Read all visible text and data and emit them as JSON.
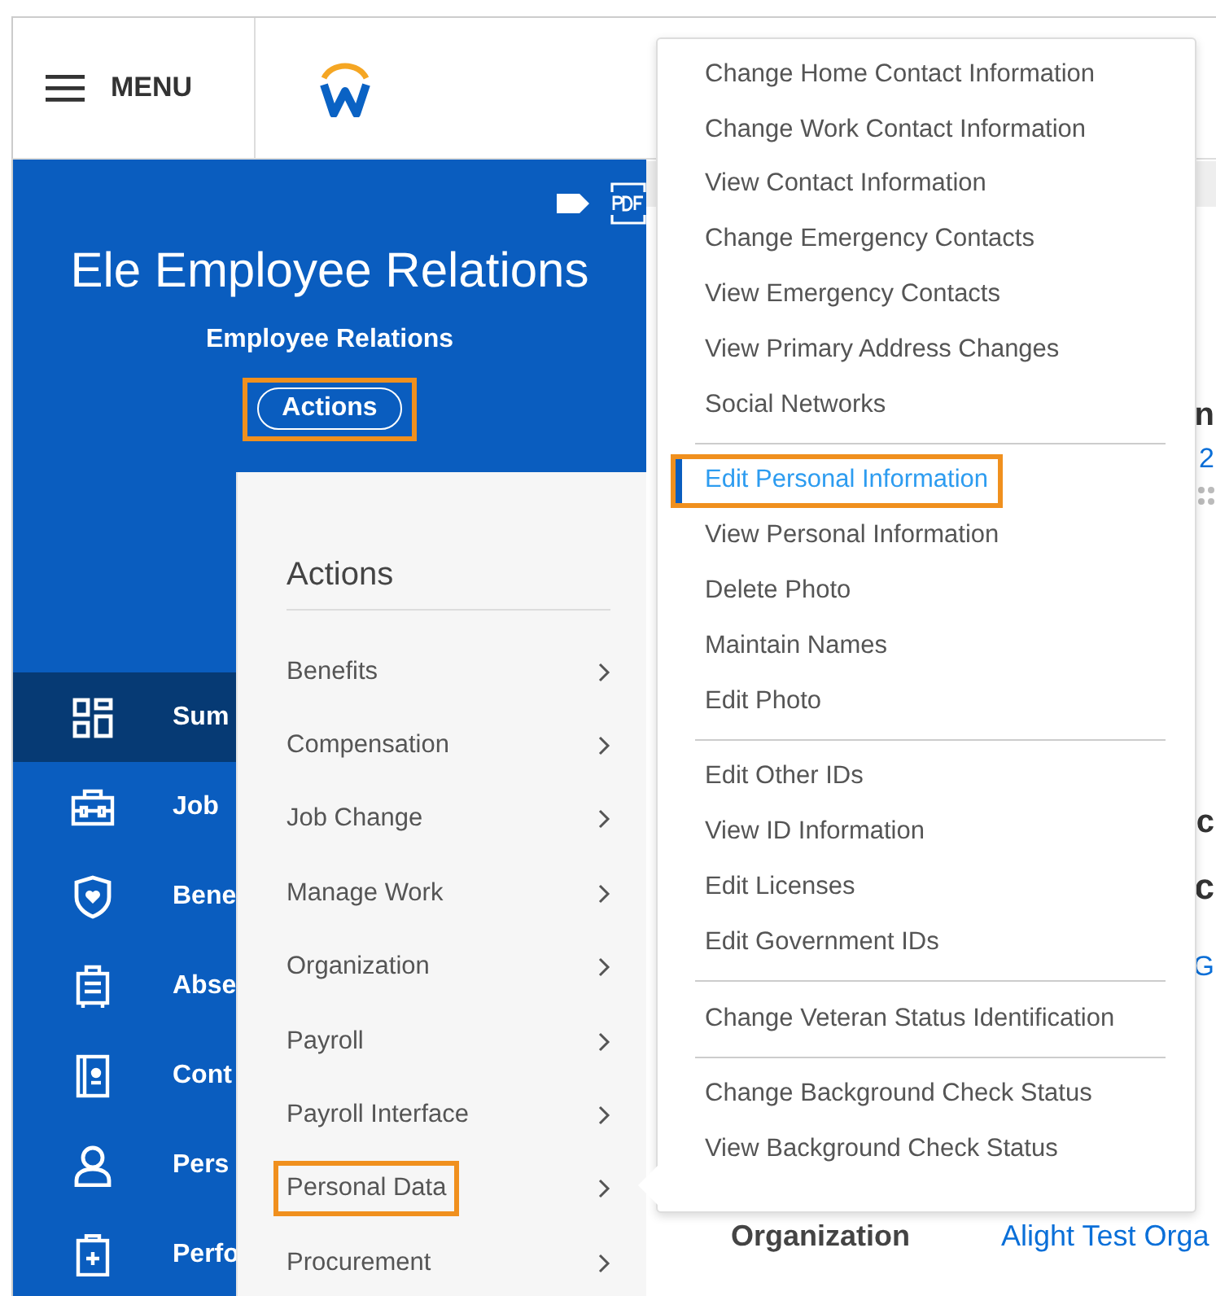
{
  "header": {
    "menu_label": "MENU"
  },
  "profile": {
    "name": "Ele Employee Relations",
    "subtitle": "Employee Relations",
    "actions_button": {
      "label": "Actions",
      "highlighted": true
    }
  },
  "sidebar": {
    "items": [
      {
        "label": "Sum",
        "selected": true
      },
      {
        "label": "Job",
        "selected": false
      },
      {
        "label": "Bene",
        "selected": false
      },
      {
        "label": "Abse",
        "selected": false
      },
      {
        "label": "Cont",
        "selected": false
      },
      {
        "label": "Pers",
        "selected": false
      },
      {
        "label": "Perfo",
        "selected": false
      }
    ]
  },
  "main": {
    "fragments": [
      {
        "kind": "heading",
        "text": "n"
      },
      {
        "kind": "link",
        "text": "2"
      },
      {
        "kind": "heading",
        "text": "c"
      },
      {
        "kind": "title",
        "text": "c"
      },
      {
        "kind": "link",
        "text": "G"
      }
    ],
    "field": {
      "label": "Organization",
      "value": "Alight Test Orga"
    }
  },
  "actions_menu": {
    "title": "Actions",
    "items": [
      {
        "label": "Benefits",
        "highlighted": false
      },
      {
        "label": "Compensation",
        "highlighted": false
      },
      {
        "label": "Job Change",
        "highlighted": false
      },
      {
        "label": "Manage Work",
        "highlighted": false
      },
      {
        "label": "Organization",
        "highlighted": false
      },
      {
        "label": "Payroll",
        "highlighted": false
      },
      {
        "label": "Payroll Interface",
        "highlighted": false
      },
      {
        "label": "Personal Data",
        "highlighted": true
      },
      {
        "label": "Procurement",
        "highlighted": false
      }
    ]
  },
  "submenu": {
    "groups": [
      {
        "items": [
          {
            "label": "Change Home Contact Information",
            "selected": false,
            "highlighted": false
          },
          {
            "label": "Change Work Contact Information",
            "selected": false,
            "highlighted": false
          },
          {
            "label": "View Contact Information",
            "selected": false,
            "highlighted": false
          },
          {
            "label": "Change Emergency Contacts",
            "selected": false,
            "highlighted": false
          },
          {
            "label": "View Emergency Contacts",
            "selected": false,
            "highlighted": false
          },
          {
            "label": "View Primary Address Changes",
            "selected": false,
            "highlighted": false
          },
          {
            "label": "Social Networks",
            "selected": false,
            "highlighted": false
          }
        ]
      },
      {
        "items": [
          {
            "label": "Edit Personal Information",
            "selected": true,
            "highlighted": true
          },
          {
            "label": "View Personal Information",
            "selected": false,
            "highlighted": false
          },
          {
            "label": "Delete Photo",
            "selected": false,
            "highlighted": false
          },
          {
            "label": "Maintain Names",
            "selected": false,
            "highlighted": false
          },
          {
            "label": "Edit Photo",
            "selected": false,
            "highlighted": false
          }
        ]
      },
      {
        "items": [
          {
            "label": "Edit Other IDs",
            "selected": false,
            "highlighted": false
          },
          {
            "label": "View ID Information",
            "selected": false,
            "highlighted": false
          },
          {
            "label": "Edit Licenses",
            "selected": false,
            "highlighted": false
          },
          {
            "label": "Edit Government IDs",
            "selected": false,
            "highlighted": false
          }
        ]
      },
      {
        "items": [
          {
            "label": "Change Veteran Status Identification",
            "selected": false,
            "highlighted": false
          }
        ]
      },
      {
        "items": [
          {
            "label": "Change Background Check Status",
            "selected": false,
            "highlighted": false
          },
          {
            "label": "View Background Check Status",
            "selected": false,
            "highlighted": false
          }
        ]
      }
    ]
  }
}
